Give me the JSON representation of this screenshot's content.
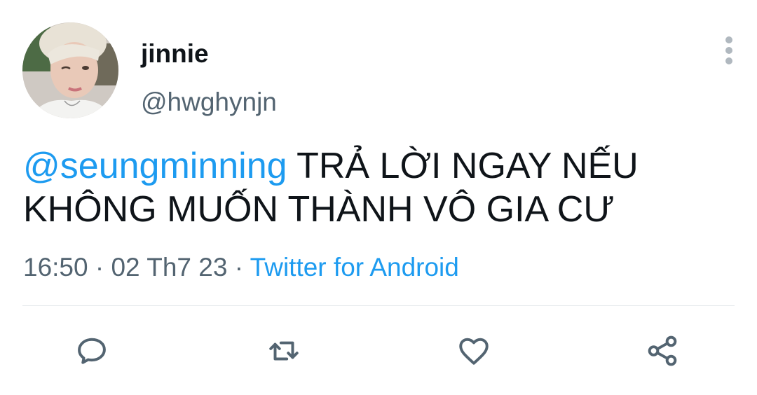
{
  "author": {
    "display_name": "jinnie",
    "handle": "@hwghynjn"
  },
  "tweet": {
    "mention": "@seungminning",
    "text": " TRẢ LỜI NGAY NẾU KHÔNG MUỐN THÀNH VÔ GIA CƯ",
    "time": "16:50",
    "sep1": " · ",
    "date": "02 Th7 23",
    "sep2": " · ",
    "source": "Twitter for Android"
  },
  "actions": [
    {
      "name": "reply",
      "icon": "reply-icon"
    },
    {
      "name": "retweet",
      "icon": "retweet-icon"
    },
    {
      "name": "like",
      "icon": "heart-icon"
    },
    {
      "name": "share",
      "icon": "share-icon"
    }
  ],
  "colors": {
    "accent": "#1d9bf0",
    "text": "#0f1419",
    "secondary": "#536471",
    "icon": "#536471"
  }
}
